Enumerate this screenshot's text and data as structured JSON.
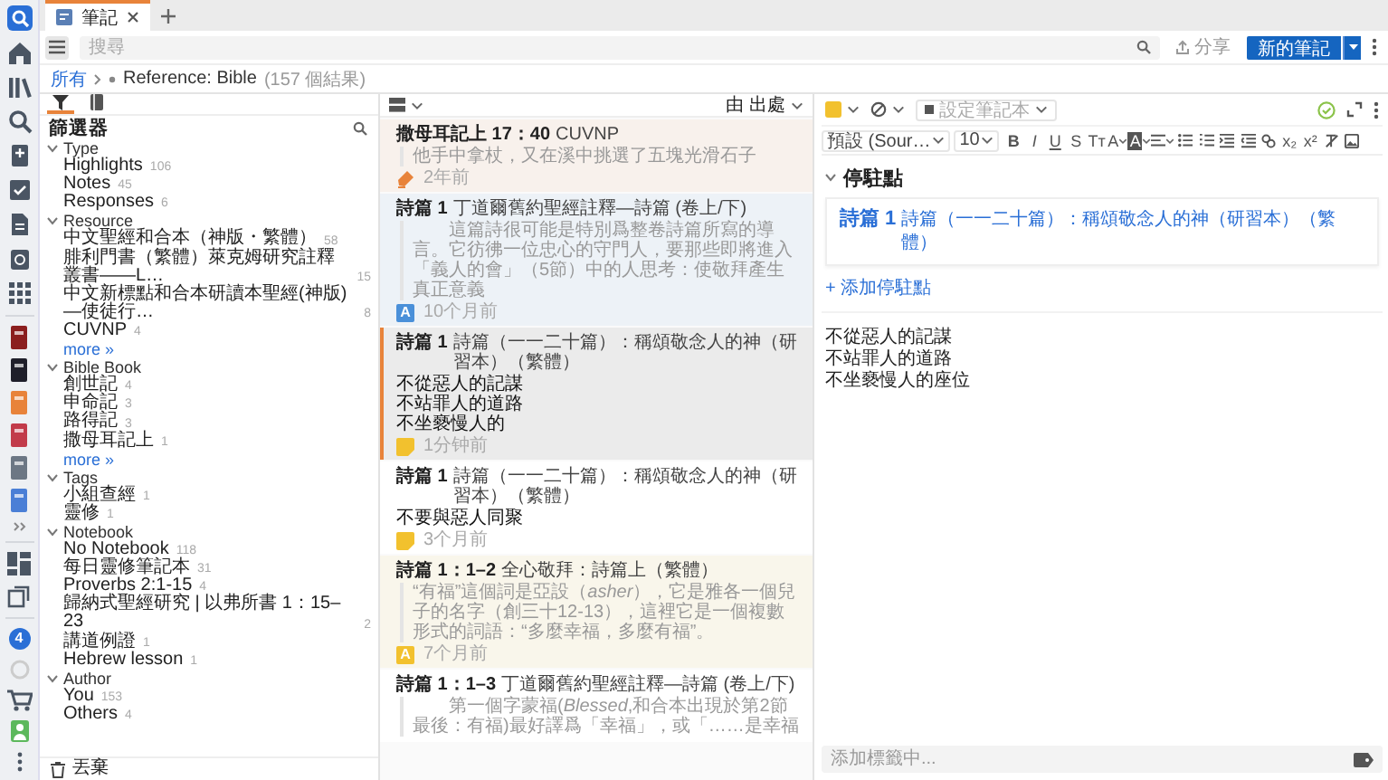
{
  "rail": {
    "badge": "4"
  },
  "tabs": [
    {
      "label": "筆記",
      "selected": true
    }
  ],
  "search": {
    "placeholder": "搜尋"
  },
  "share_button": "分享",
  "new_note_button": "新的筆記",
  "breadcrumb": {
    "root": "所有",
    "current": "Reference: Bible",
    "count": "(157 個結果)"
  },
  "filter_tabs": [
    {
      "kind": "filter",
      "selected": true
    },
    {
      "kind": "notebook",
      "selected": false
    }
  ],
  "filter": {
    "title": "篩選器",
    "trash": "丟棄",
    "groups": [
      {
        "label": "Type",
        "expanded": true,
        "items": [
          {
            "label": "Highlights",
            "count": "106"
          },
          {
            "label": "Notes",
            "count": "45"
          },
          {
            "label": "Responses",
            "count": "6"
          }
        ]
      },
      {
        "label": "Resource",
        "expanded": true,
        "items": [
          {
            "label": "中文聖經和合本（神版・繁體）",
            "count": "58"
          },
          {
            "label": "腓利門書（繁體）萊克姆研究註釋叢書——L…",
            "count": "15"
          },
          {
            "label": "中文新標點和合本研讀本聖經(神版)—使徒行…",
            "count": "8"
          },
          {
            "label": "CUVNP",
            "count": "4"
          }
        ],
        "more": "more »"
      },
      {
        "label": "Bible Book",
        "expanded": true,
        "items": [
          {
            "label": "創世記",
            "count": "4"
          },
          {
            "label": "申命記",
            "count": "3"
          },
          {
            "label": "路得記",
            "count": "3"
          },
          {
            "label": "撒母耳記上",
            "count": "1"
          }
        ],
        "more": "more »"
      },
      {
        "label": "Tags",
        "expanded": true,
        "items": [
          {
            "label": "小組查經",
            "count": "1"
          },
          {
            "label": "靈修",
            "count": "1"
          }
        ]
      },
      {
        "label": "Notebook",
        "expanded": true,
        "items": [
          {
            "label": "No Notebook",
            "count": "118"
          },
          {
            "label": "每日靈修筆記本",
            "count": "31"
          },
          {
            "label": "Proverbs 2:1-15",
            "count": "4"
          },
          {
            "label": "歸納式聖經研究 | 以弗所書 1：15–23",
            "count": "2"
          },
          {
            "label": "講道例證",
            "count": "1"
          },
          {
            "label": "Hebrew lesson",
            "count": "1"
          }
        ]
      },
      {
        "label": "Author",
        "expanded": true,
        "items": [
          {
            "label": "You",
            "count": "153"
          },
          {
            "label": "Others",
            "count": "4"
          }
        ]
      }
    ]
  },
  "list": {
    "sort": "由 出處",
    "notes": [
      {
        "kind": "highlight",
        "color": "#e8833a",
        "selected": false,
        "title": "撒母耳記上 17：40",
        "source": "CUVNP",
        "quote": "他手中拿杖，又在溪中挑選了五塊光滑石子",
        "indent": false,
        "time": "2年前"
      },
      {
        "kind": "text_style",
        "color": "#4a90d9",
        "badge": "A",
        "selected": false,
        "title": "詩篇 1",
        "source": "丁道爾舊約聖經註釋—詩篇 (卷上/下)",
        "quote": "這篇詩很可能是特別爲整卷詩篇所寫的導言。它彷彿一位忠心的守門人，要那些即將進入「義人的會」（5節）中的人思考：使敬拜產生真正意義",
        "indent": true,
        "time": "10个月前"
      },
      {
        "kind": "note",
        "color": "#f2c12e",
        "selected": true,
        "title": "詩篇 1",
        "source": "詩篇（一一二十篇）：稱頌敬念人的神（研習本）（繁體）",
        "lines": [
          "不從惡人的記謀",
          "不站罪人的道路",
          "不坐褻慢人的"
        ],
        "time": "1分钟前"
      },
      {
        "kind": "note",
        "color": "#f2c12e",
        "selected": false,
        "title": "詩篇 1",
        "source": "詩篇（一一二十篇）：稱頌敬念人的神（研習本）（繁體）",
        "lines": [
          "不要與惡人同聚"
        ],
        "time": "3个月前"
      },
      {
        "kind": "text_style",
        "color": "#f2c12e",
        "badge": "A",
        "selected": false,
        "title": "詩篇 1：1–2",
        "source": "全心敬拜：詩篇上（繁體）",
        "quote": "“有福”這個詞是亞設（*asher*），它是雅各一個兒子的名字（創三十12-13），這裡它是一個複數形式的詞語：“多麼幸福，多麼有福”。",
        "indent": false,
        "time": "7个月前"
      },
      {
        "kind": "text_style",
        "selected": false,
        "title": "詩篇 1：1–3",
        "source": "丁道爾舊約聖經註釋—詩篇 (卷上/下)",
        "quote": "第一個字蒙福(*Blessed*,和合本出現於第2節最後：有福)最好譯爲「幸福」，或「……是幸福",
        "indent": true
      }
    ]
  },
  "editor": {
    "notebook_placeholder": "設定筆記本",
    "saved": true,
    "font": "預設 (Sour…",
    "font_size": "10",
    "format_buttons": [
      {
        "kind": "bold",
        "label": "B"
      },
      {
        "kind": "italic",
        "label": "I"
      },
      {
        "kind": "underline",
        "label": "U"
      },
      {
        "kind": "strike",
        "label": "S"
      },
      {
        "kind": "case",
        "label": "Tт"
      },
      {
        "kind": "text_color",
        "label": "A"
      },
      {
        "kind": "back_color",
        "label": "A"
      },
      {
        "kind": "align"
      },
      {
        "kind": "bullets"
      },
      {
        "kind": "numbers"
      },
      {
        "kind": "indent"
      },
      {
        "kind": "outdent"
      },
      {
        "kind": "link"
      },
      {
        "kind": "subscript",
        "label": "x₂"
      },
      {
        "kind": "superscript",
        "label": "x²"
      },
      {
        "kind": "clear"
      },
      {
        "kind": "image"
      }
    ],
    "pins_title": "停駐點",
    "pins_expanded": true,
    "pins": [
      {
        "title": "詩篇 1",
        "source": "詩篇（一一二十篇）：稱頌敬念人的神（研習本）（繁體）"
      }
    ],
    "add_pin": "+ 添加停駐點",
    "body": [
      "不從惡人的記謀",
      "不站罪人的道路",
      "不坐褻慢人的座位"
    ],
    "tag_placeholder": "添加標籤中..."
  }
}
